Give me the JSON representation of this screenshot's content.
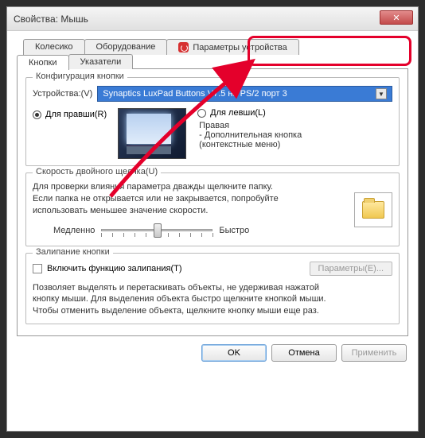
{
  "window": {
    "title": "Свойства: Мышь"
  },
  "tabs": {
    "row1": {
      "wheel": "Колесико",
      "hardware": "Оборудование",
      "device_params": "Параметры устройства"
    },
    "row2": {
      "buttons": "Кнопки",
      "pointers": "Указатели"
    }
  },
  "config": {
    "group_title": "Конфигурация кнопки",
    "device_label": "Устройства:(V)",
    "device_value": "Synaptics LuxPad Buttons V7.5 на PS/2 порт 3",
    "right_handed": "Для правши(R)",
    "left_handed": "Для левши(L)",
    "right_heading": "Правая",
    "right_text1": "- Дополнительная кнопка",
    "right_text2": "(контекстные меню)"
  },
  "speed": {
    "group_title": "Скорость двойного щелчка(U)",
    "hint1": "Для проверки влияния параметра дважды щелкните папку.",
    "hint2": "Если папка не открывается или не закрывается, попробуйте",
    "hint3": "использовать меньшее значение скорости.",
    "slow": "Медленно",
    "fast": "Быстро"
  },
  "sticky": {
    "group_title": "Залипание кнопки",
    "enable_label": "Включить функцию залипания(T)",
    "params_btn": "Параметры(E)...",
    "desc1": "Позволяет выделять и перетаскивать объекты, не удерживая нажатой",
    "desc2": "кнопку мыши. Для выделения объекта быстро щелкните кнопкой мыши.",
    "desc3": "Чтобы отменить выделение объекта, щелкните кнопку мыши еще раз."
  },
  "footer": {
    "ok": "OK",
    "cancel": "Отмена",
    "apply": "Применить"
  }
}
